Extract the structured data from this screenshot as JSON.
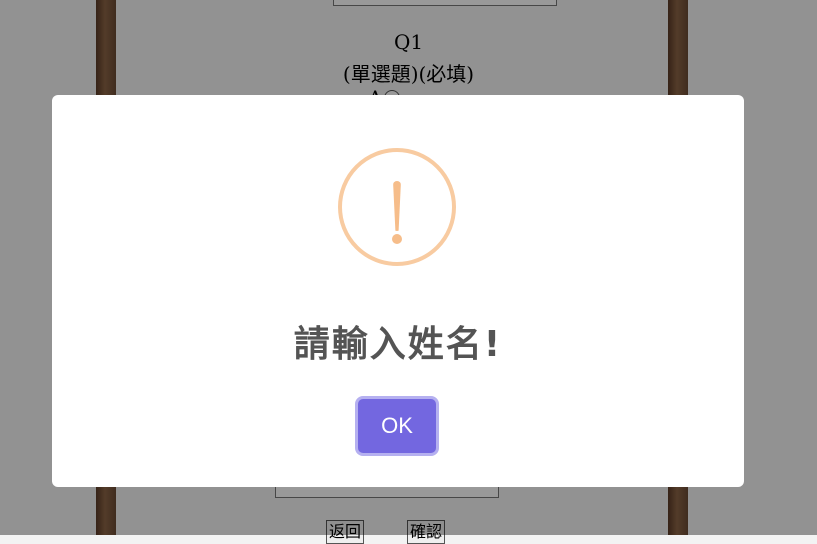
{
  "background": {
    "question": {
      "number": "Q1",
      "type_label": "(單選題)(必填)",
      "option_label": "A"
    },
    "buttons": {
      "back": "返回",
      "confirm": "確認"
    }
  },
  "alert": {
    "icon": "warning-exclamation-icon",
    "icon_color": "#f8bb86",
    "message": "請輸入姓名!",
    "ok_label": "OK",
    "ok_color": "#7367f0"
  }
}
